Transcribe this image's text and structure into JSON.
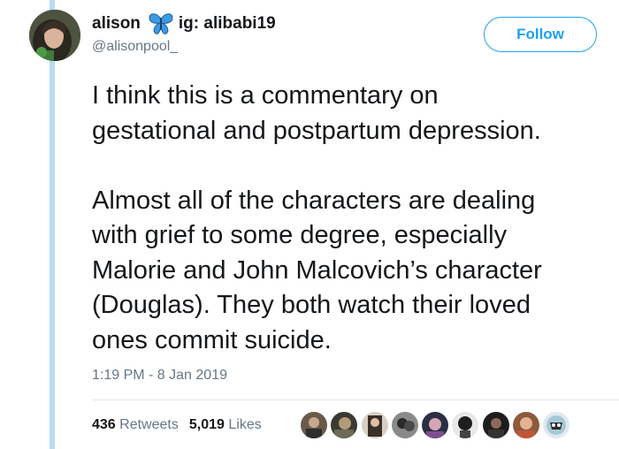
{
  "tweet": {
    "display_name": "alison",
    "display_name_suffix": "ig: alibabi19",
    "name_emoji_icon": "butterfly-icon",
    "handle": "@alisonpool_",
    "follow_label": "Follow",
    "text_lines_1": [
      "I think this is a commentary on",
      "gestational and postpartum depression."
    ],
    "text_lines_2": [
      "Almost all of the characters are dealing",
      "with grief to some degree, especially",
      "Malorie and John Malcovich’s character",
      "(Douglas). They both watch their loved",
      "ones commit suicide."
    ],
    "timestamp": "1:19 PM - 8 Jan 2019",
    "retweets_count": "436",
    "retweets_label": "Retweets",
    "likes_count": "5,019",
    "likes_label": "Likes"
  },
  "colors": {
    "accent": "#1da1f2",
    "thread_line": "#b8dcf3",
    "secondary_text": "#657786"
  }
}
